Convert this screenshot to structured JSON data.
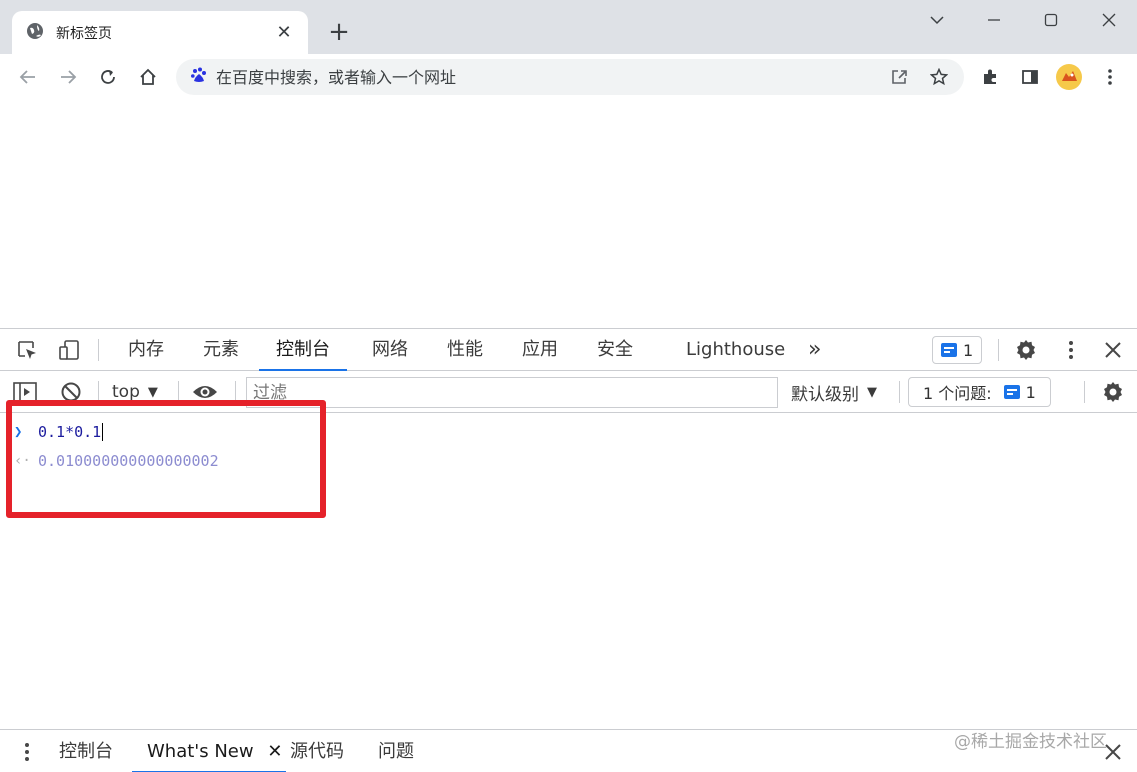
{
  "browser": {
    "tab_title": "新标签页",
    "new_tab": "+",
    "omnibox_placeholder": "在百度中搜索，或者输入一个网址"
  },
  "devtools": {
    "tabs": [
      "内存",
      "元素",
      "控制台",
      "网络",
      "性能",
      "应用",
      "安全",
      "Lighthouse"
    ],
    "active_tab": "控制台",
    "more": "»",
    "issues_count": "1",
    "console_bar": {
      "context": "top",
      "filter_placeholder": "过滤",
      "levels": "默认级别",
      "issues_label": "1 个问题:",
      "issues_count": "1"
    },
    "console": {
      "input": "0.1*0.1",
      "output": "0.010000000000000002"
    },
    "drawer": {
      "tabs": [
        "控制台",
        "What's New",
        "源代码",
        "问题"
      ],
      "active": "What's New"
    }
  },
  "watermark": "@稀土掘金技术社区",
  "colors": {
    "accent": "#1a73e8",
    "highlight": "#e5222a",
    "tabstrip": "#dee1e6"
  }
}
